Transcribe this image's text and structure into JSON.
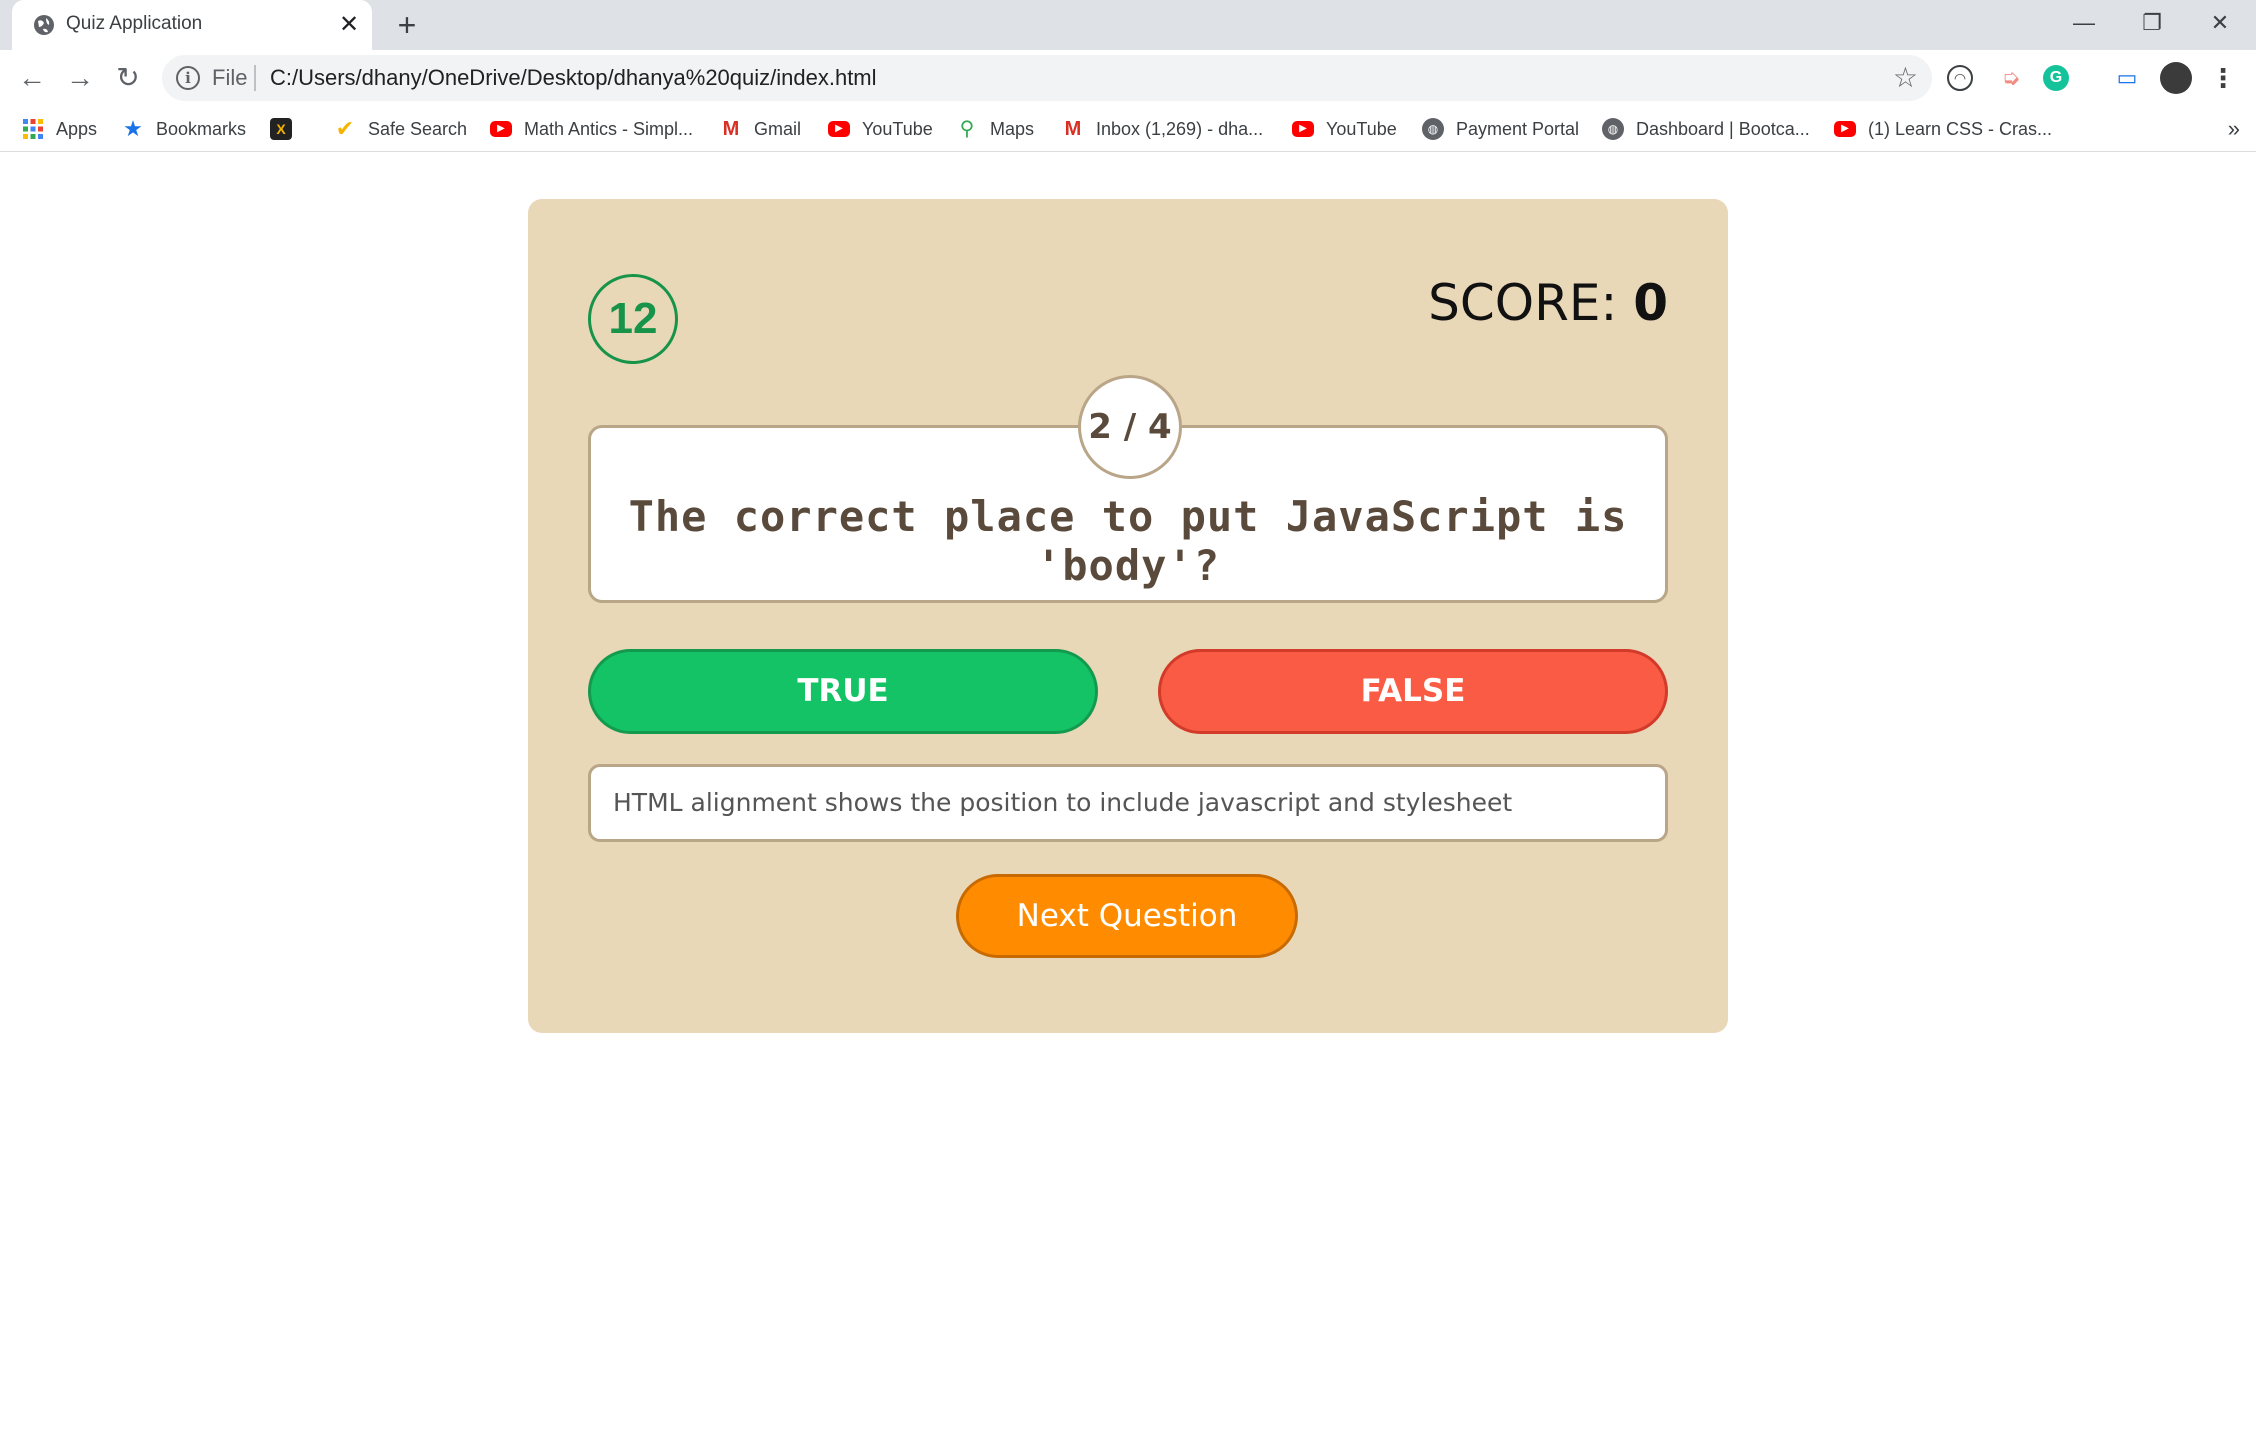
{
  "browser": {
    "tab_title": "Quiz Application",
    "tab_close": "✕",
    "new_tab": "+",
    "window_controls": {
      "minimize": "—",
      "restore": "❐",
      "close": "✕"
    },
    "nav": {
      "back": "←",
      "forward": "→",
      "reload": "↻"
    },
    "address": {
      "scheme_label": "File",
      "url": "C:/Users/dhany/OneDrive/Desktop/dhanya%20quiz/index.html",
      "star": "☆"
    },
    "extensions": [
      "headphones-icon",
      "cast-arrow-icon",
      "grammarly-icon",
      "cast-icon",
      "avatar"
    ],
    "menu": "⋮"
  },
  "bookmarks": {
    "items": [
      {
        "label": "Apps",
        "icon": "apps-grid-icon"
      },
      {
        "label": "Bookmarks",
        "icon": "star-icon"
      },
      {
        "label": "",
        "icon": "app-logo-icon"
      },
      {
        "label": "Safe Search",
        "icon": "check-icon"
      },
      {
        "label": "Math Antics - Simpl...",
        "icon": "youtube-icon"
      },
      {
        "label": "Gmail",
        "icon": "gmail-icon"
      },
      {
        "label": "YouTube",
        "icon": "youtube-icon"
      },
      {
        "label": "Maps",
        "icon": "maps-pin-icon"
      },
      {
        "label": "Inbox (1,269) - dha...",
        "icon": "gmail-icon"
      },
      {
        "label": "YouTube",
        "icon": "youtube-icon"
      },
      {
        "label": "Payment Portal",
        "icon": "globe-icon"
      },
      {
        "label": "Dashboard | Bootca...",
        "icon": "globe-icon"
      },
      {
        "label": "(1) Learn CSS - Cras...",
        "icon": "youtube-icon"
      }
    ],
    "more": "»"
  },
  "quiz": {
    "timer": "12",
    "score_label": "SCORE: ",
    "score_value": "0",
    "counter": "2 / 4",
    "question": "The correct place to put JavaScript is 'body'?",
    "true_label": "TRUE",
    "false_label": "FALSE",
    "explanation": "HTML alignment shows the position to include javascript and stylesheet",
    "next_label": "Next Question",
    "colors": {
      "card": "#e9d8b8",
      "true": "#13c366",
      "false": "#f95b44",
      "next": "#ff8c00",
      "timer": "#17944a"
    }
  }
}
